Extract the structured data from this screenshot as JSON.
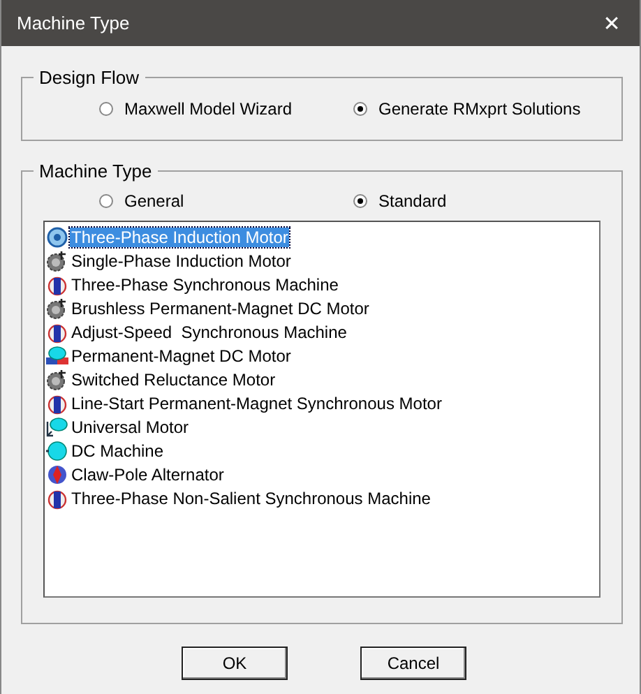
{
  "window": {
    "title": "Machine Type",
    "close": "✕"
  },
  "design_flow": {
    "title": "Design Flow",
    "options": [
      {
        "label": "Maxwell Model Wizard",
        "selected": false
      },
      {
        "label": "Generate RMxprt Solutions",
        "selected": true
      }
    ]
  },
  "machine_type": {
    "title": "Machine Type",
    "options": [
      {
        "label": "General",
        "selected": false
      },
      {
        "label": "Standard",
        "selected": true
      }
    ],
    "items": [
      {
        "label": "Three-Phase Induction Motor",
        "kind": "ring",
        "selected": true
      },
      {
        "label": "Single-Phase Induction Motor",
        "kind": "gear",
        "selected": false
      },
      {
        "label": "Three-Phase Synchronous Machine",
        "kind": "rotor",
        "selected": false
      },
      {
        "label": "Brushless Permanent-Magnet DC Motor",
        "kind": "gear",
        "selected": false
      },
      {
        "label": "Adjust-Speed  Synchronous Machine",
        "kind": "rotor",
        "selected": false
      },
      {
        "label": "Permanent-Magnet DC Motor",
        "kind": "magnet",
        "selected": false
      },
      {
        "label": "Switched Reluctance Motor",
        "kind": "gear",
        "selected": false
      },
      {
        "label": "Line-Start Permanent-Magnet Synchronous Motor",
        "kind": "rotor",
        "selected": false
      },
      {
        "label": "Universal Motor",
        "kind": "universal",
        "selected": false
      },
      {
        "label": "DC Machine",
        "kind": "dc",
        "selected": false
      },
      {
        "label": "Claw-Pole Alternator",
        "kind": "claw",
        "selected": false
      },
      {
        "label": "Three-Phase Non-Salient Synchronous Machine",
        "kind": "rotor",
        "selected": false
      }
    ]
  },
  "buttons": [
    "OK",
    "Cancel"
  ]
}
